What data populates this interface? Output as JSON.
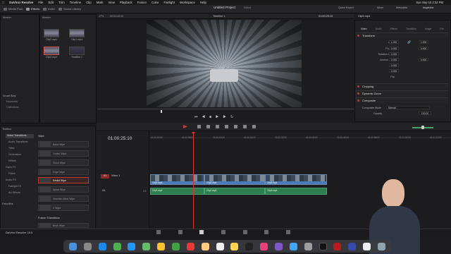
{
  "menubar": {
    "apple": "",
    "app": "DaVinci Resolve",
    "items": [
      "File",
      "Edit",
      "Trim",
      "Timeline",
      "Clip",
      "Mark",
      "View",
      "Playback",
      "Fusion",
      "Color",
      "Fairlight",
      "Workspace",
      "Help"
    ],
    "clock": "Sun Sep 10 2:32 PM"
  },
  "toolbar": {
    "media_pool": "Media Pool",
    "effects": "Effects",
    "index": "Index",
    "sound_library": "Sound Library",
    "project_title": "Untitled Project",
    "edited": "Edited",
    "quick_export": "Quick Export",
    "mixer": "Mixer",
    "metadata": "Metadata",
    "inspector": "Inspector",
    "zoom": "17%",
    "src_tc": "00:01:42:15",
    "timeline_name": "Timeline 1",
    "tc": "01:00:25:15",
    "clip_name": "Clip3.mp4"
  },
  "media_pool": {
    "master": "Master",
    "bin_header": "Master",
    "clips": [
      "Clip2.mp4",
      "Clip1.mp4",
      "Clip3.mp4",
      "Timeline 1"
    ],
    "smart_bins": "Smart Bins",
    "keywords": "Keywords",
    "collections": "Collections"
  },
  "effects": {
    "toolbox": "Toolbox",
    "categories": [
      "Video Transitions",
      "Audio Transitions",
      "Titles",
      "Generators",
      "Effects",
      "Open FX",
      "Filters",
      "Audio FX",
      "Fairlight FX",
      "AU Effects"
    ],
    "favorites": "Favorites",
    "group": "Wipe",
    "items": [
      "Band Wipe",
      "Center Wipe",
      "Clock Wipe",
      "Edge Wipe",
      "Radial Wipe",
      "Spiral Wipe",
      "Venetian Blind Wipe",
      "X Wipe"
    ],
    "fusion_transitions": "Fusion Transitions",
    "next_item": "Brick Wipe"
  },
  "inspector": {
    "tabs": [
      "Video",
      "Audio",
      "Effects",
      "Transition",
      "Image",
      "File"
    ],
    "transform": "Transform",
    "rows": [
      {
        "label": "Zoom",
        "x": "1.000",
        "y": "1.000"
      },
      {
        "label": "Position",
        "x": "0.000",
        "y": "0.000"
      },
      {
        "label": "Rotation Angle",
        "x": "0.000",
        "y": ""
      },
      {
        "label": "Anchor Point",
        "x": "0.000",
        "y": "0.000"
      },
      {
        "label": "Pitch",
        "x": "0.000",
        "y": ""
      },
      {
        "label": "Yaw",
        "x": "0.000",
        "y": ""
      },
      {
        "label": "Flip",
        "x": "",
        "y": ""
      }
    ],
    "cropping": "Cropping",
    "dynamic_zoom": "Dynamic Zoom",
    "composite": "Composite",
    "composite_mode_label": "Composite Mode",
    "composite_mode_value": "Normal",
    "opacity_label": "Opacity",
    "opacity_value": "100.00"
  },
  "timeline": {
    "timecode": "01:00:25:10",
    "ruler": [
      "01:00:00:00",
      "01:00:08:00",
      "01:00:16:00",
      "01:00:24:00",
      "01:00:32:00",
      "01:00:40:00",
      "01:00:48:00",
      "01:00:56:00",
      "01:01:04:00",
      "01:01:12:00"
    ],
    "video_track": "V1",
    "video_track_name": "Video 1",
    "audio_track": "A1",
    "audio_level": "2.0",
    "video_clips": [
      "Clip1.mp4",
      "Clip2.mp4",
      "Clip3.mp4"
    ],
    "audio_clips": [
      "Clip1.mp4",
      "Clip2.mp4",
      "Clip3.mp4"
    ]
  },
  "statusbar": {
    "app_version": "DaVinci Resolve 18.5"
  },
  "colors": {
    "accent_red": "#e05050",
    "video_clip_border": "#6a88b0",
    "audio_clip": "#2e7d4f",
    "playhead": "#e03030"
  }
}
